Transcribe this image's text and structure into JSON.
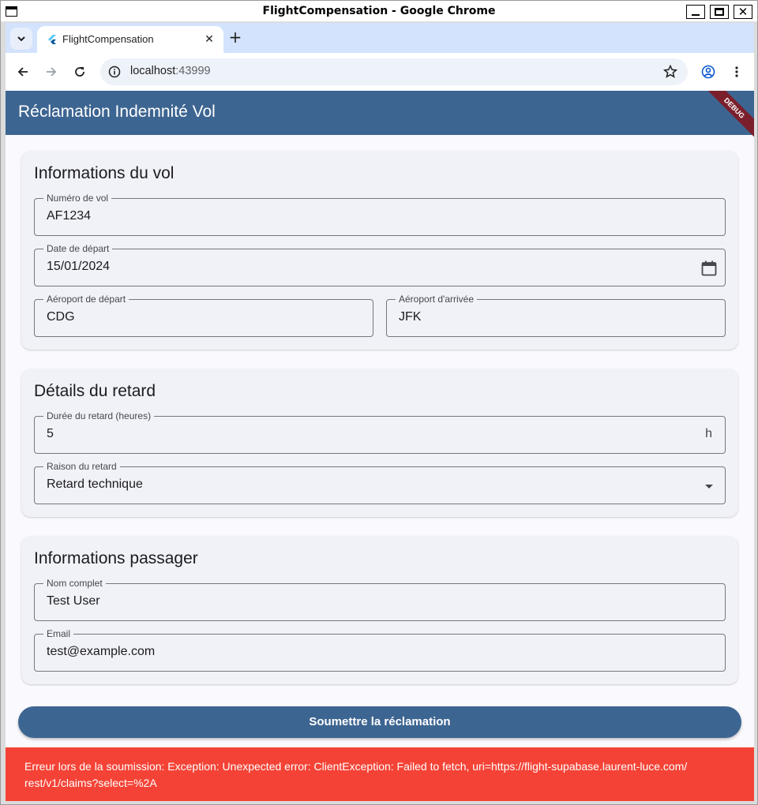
{
  "window": {
    "title": "FlightCompensation - Google Chrome",
    "close_glyph": "✕"
  },
  "browser": {
    "tab": {
      "title": "FlightCompensation",
      "close_glyph": "✕"
    },
    "new_tab_glyph": "+",
    "url_host": "localhost",
    "url_port": ":43999"
  },
  "app": {
    "title": "Réclamation Indemnité Vol",
    "debug_banner": "DEBUG",
    "flight_card": {
      "title": "Informations du vol",
      "flight_number": {
        "label": "Numéro de vol",
        "value": "AF1234"
      },
      "departure_date": {
        "label": "Date de départ",
        "value": "15/01/2024"
      },
      "departure_airport": {
        "label": "Aéroport de départ",
        "value": "CDG"
      },
      "arrival_airport": {
        "label": "Aéroport d'arrivée",
        "value": "JFK"
      }
    },
    "delay_card": {
      "title": "Détails du retard",
      "duration": {
        "label": "Durée du retard (heures)",
        "value": "5",
        "suffix": "h"
      },
      "reason": {
        "label": "Raison du retard",
        "value": "Retard technique"
      }
    },
    "passenger_card": {
      "title": "Informations passager",
      "full_name": {
        "label": "Nom complet",
        "value": "Test User"
      },
      "email": {
        "label": "Email",
        "value": "test@example.com"
      }
    },
    "submit_label": "Soumettre la réclamation",
    "error_message": "Erreur lors de la soumission: Exception: Unexpected error: ClientException: Failed to fetch, uri=https://flight-supabase.laurent-luce.com/ rest/v1/claims?select=%2A"
  },
  "colors": {
    "app_bar": "#3d6591",
    "error": "#f44336",
    "card_bg": "#f1f2f8",
    "page_bg": "#f9f9fe"
  }
}
